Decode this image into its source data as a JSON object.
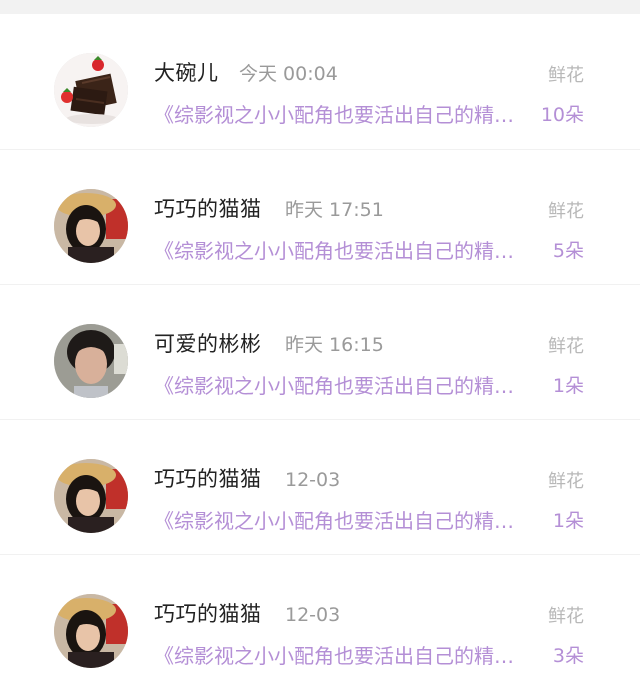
{
  "messages": [
    {
      "name": "大碗儿",
      "time": "今天 00:04",
      "preview": "《综影视之小小配角也要活出自己的精彩》",
      "gift_label": "鲜花",
      "gift_count": "10朵",
      "avatar": "chocolate-strawberry"
    },
    {
      "name": "巧巧的猫猫",
      "time": "昨天 17:51",
      "preview": "《综影视之小小配角也要活出自己的精彩》",
      "gift_label": "鲜花",
      "gift_count": "5朵",
      "avatar": "woman-straw-hat"
    },
    {
      "name": "可爱的彬彬",
      "time": "昨天 16:15",
      "preview": "《综影视之小小配角也要活出自己的精彩》",
      "gift_label": "鲜花",
      "gift_count": "1朵",
      "avatar": "short-hair-person"
    },
    {
      "name": "巧巧的猫猫",
      "time": "12-03",
      "preview": "《综影视之小小配角也要活出自己的精彩》",
      "gift_label": "鲜花",
      "gift_count": "1朵",
      "avatar": "woman-straw-hat"
    },
    {
      "name": "巧巧的猫猫",
      "time": "12-03",
      "preview": "《综影视之小小配角也要活出自己的精彩》",
      "gift_label": "鲜花",
      "gift_count": "3朵",
      "avatar": "woman-straw-hat"
    }
  ]
}
